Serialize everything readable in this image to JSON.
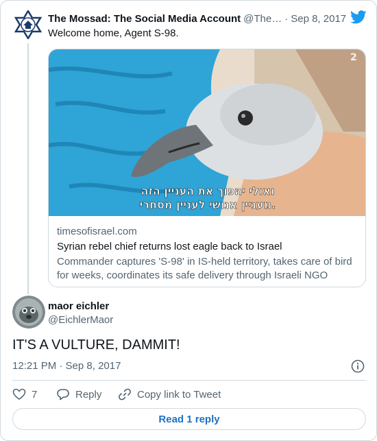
{
  "parent_tweet": {
    "author_name": "The Mossad: The Social Media Account",
    "author_handle": "@The…",
    "separator": "·",
    "date": "Sep 8, 2017",
    "text": "Welcome home, Agent S-98.",
    "avatar_icon": "mossad-emblem-icon",
    "platform_icon": "twitter-bird-icon",
    "link_card": {
      "domain": "timesofisrael.com",
      "title": "Syrian rebel chief returns lost eagle back to Israel",
      "description": "Commander captures 'S-98' in IS-held territory, takes care of bird for weeks, coordinates its safe delivery through Israeli NGO",
      "image_subtitle_line1": "ואולי יהפוך את העניין הזה",
      "image_subtitle_line2": "מעניין אנושי לעניין מסחרי."
    }
  },
  "tweet": {
    "author_name": "maor eichler",
    "author_handle": "@EichlerMaor",
    "text": "IT'S A VULTURE, DAMMIT!",
    "timestamp": "12:21 PM · Sep 8, 2017",
    "avatar_icon": "user-avatar",
    "info_icon": "info-icon"
  },
  "actions": {
    "like_count": "7",
    "reply_label": "Reply",
    "copy_link_label": "Copy link to Tweet"
  },
  "footer": {
    "read_reply_label": "Read 1 reply"
  },
  "colors": {
    "text": "#0f1419",
    "secondary": "#536471",
    "border": "#cfd9de",
    "twitter_blue": "#1d9bf0",
    "link_blue": "#1d72c4"
  }
}
